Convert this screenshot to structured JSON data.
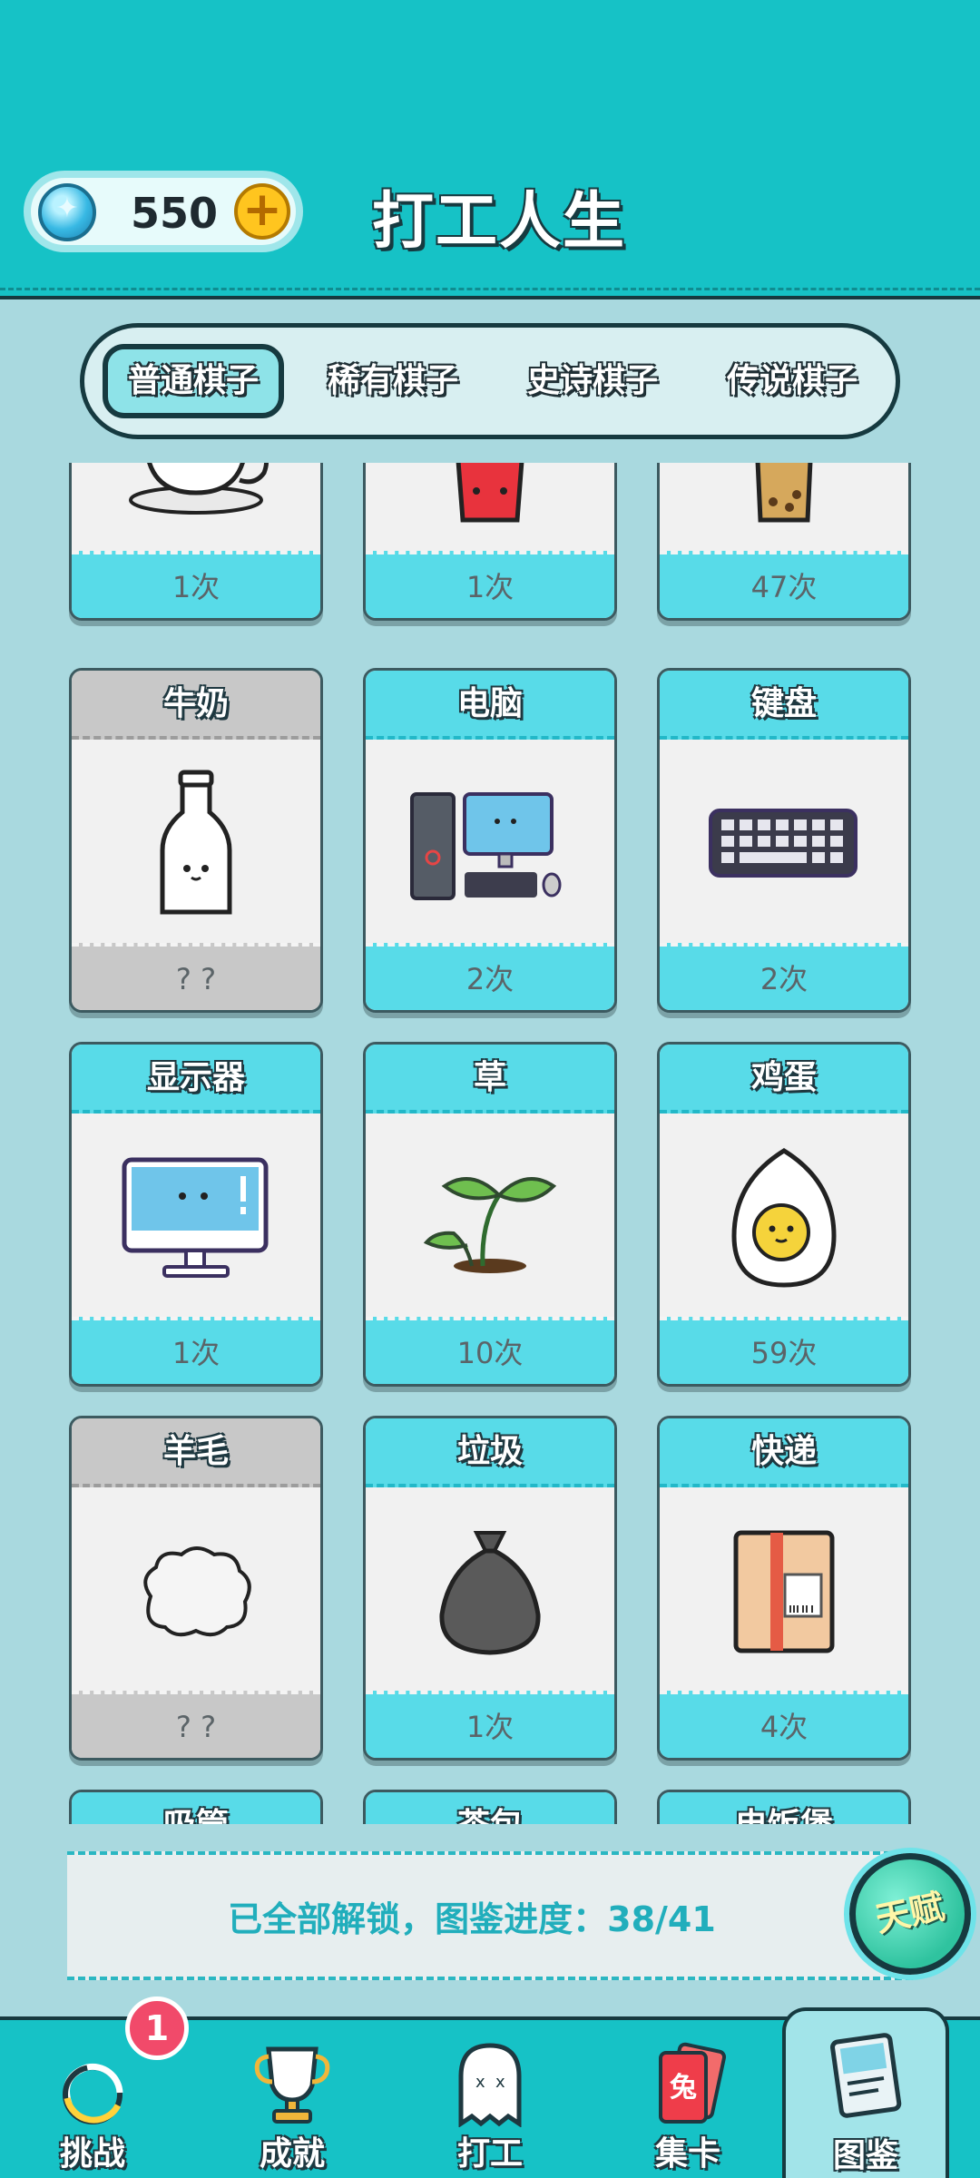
{
  "header": {
    "gems": "550",
    "title": "打工人生"
  },
  "tabs": [
    {
      "label": "普通棋子",
      "active": true
    },
    {
      "label": "稀有棋子",
      "active": false
    },
    {
      "label": "史诗棋子",
      "active": false
    },
    {
      "label": "传说棋子",
      "active": false
    }
  ],
  "cards": {
    "row0": [
      {
        "name": "",
        "count": "1次",
        "icon": "coffee-cup-icon"
      },
      {
        "name": "",
        "count": "1次",
        "icon": "red-cup-icon"
      },
      {
        "name": "",
        "count": "47次",
        "icon": "milk-tea-icon"
      }
    ],
    "row1": [
      {
        "name": "牛奶",
        "count": "? ?",
        "icon": "milk-bottle-icon",
        "locked": true
      },
      {
        "name": "电脑",
        "count": "2次",
        "icon": "computer-icon"
      },
      {
        "name": "键盘",
        "count": "2次",
        "icon": "keyboard-icon"
      }
    ],
    "row2": [
      {
        "name": "显示器",
        "count": "1次",
        "icon": "monitor-icon"
      },
      {
        "name": "草",
        "count": "10次",
        "icon": "sprout-icon"
      },
      {
        "name": "鸡蛋",
        "count": "59次",
        "icon": "egg-icon"
      }
    ],
    "row3": [
      {
        "name": "羊毛",
        "count": "? ?",
        "icon": "wool-icon",
        "locked": true
      },
      {
        "name": "垃圾",
        "count": "1次",
        "icon": "trash-bag-icon"
      },
      {
        "name": "快递",
        "count": "4次",
        "icon": "parcel-icon"
      }
    ],
    "row4": [
      {
        "name": "吸管",
        "icon": "card-partial"
      },
      {
        "name": "茶包",
        "icon": "card-partial"
      },
      {
        "name": "电饭煲",
        "icon": "card-partial"
      }
    ]
  },
  "status": {
    "text": "已全部解锁，图鉴进度：38/41",
    "talent": "天赋"
  },
  "nav": [
    {
      "label": "挑战",
      "icon": "challenge-icon",
      "badge": "1"
    },
    {
      "label": "成就",
      "icon": "trophy-icon"
    },
    {
      "label": "打工",
      "icon": "ghost-icon"
    },
    {
      "label": "集卡",
      "icon": "cards-icon",
      "card_text": "兔"
    },
    {
      "label": "图鉴",
      "icon": "book-icon",
      "active": true
    }
  ],
  "colors": {
    "header": "#16c2c6",
    "background": "#a9d9df",
    "card_header": "#58dbe8",
    "locked": "#c8c8c8",
    "status_text": "#21aebc"
  }
}
